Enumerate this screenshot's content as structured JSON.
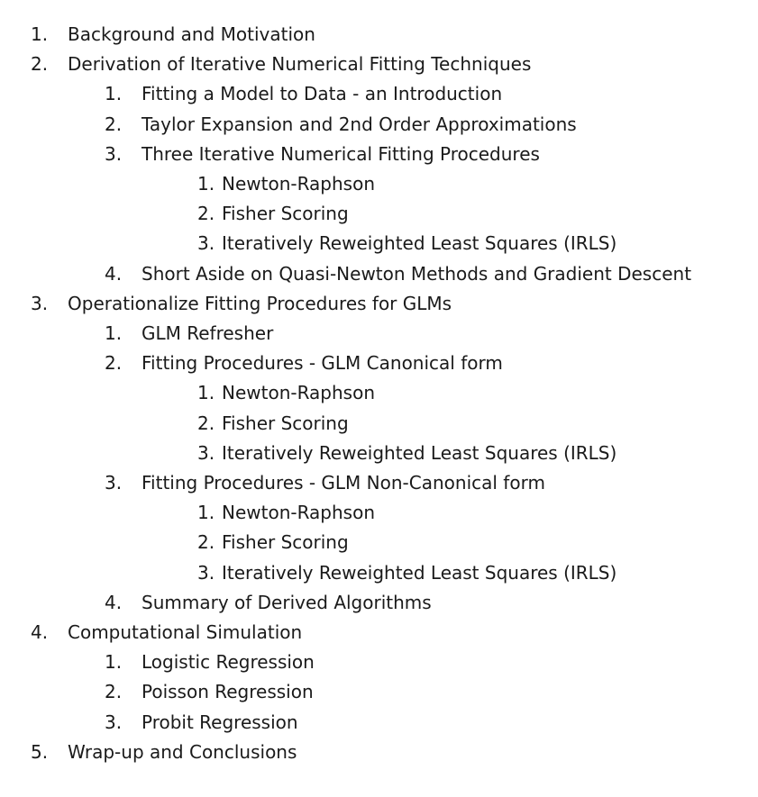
{
  "outline": [
    {
      "level": 1,
      "number": "1.",
      "text": "Background and Motivation"
    },
    {
      "level": 1,
      "number": "2.",
      "text": "Derivation of Iterative Numerical Fitting Techniques"
    },
    {
      "level": 2,
      "number": "1.",
      "text": "Fitting a Model to Data - an Introduction"
    },
    {
      "level": 2,
      "number": "2.",
      "text": "Taylor Expansion and 2nd Order Approximations"
    },
    {
      "level": 2,
      "number": "3.",
      "text": "Three Iterative Numerical Fitting Procedures"
    },
    {
      "level": 3,
      "number": "1.",
      "text": "Newton-Raphson"
    },
    {
      "level": 3,
      "number": "2.",
      "text": "Fisher Scoring"
    },
    {
      "level": 3,
      "number": "3.",
      "text": "Iteratively Reweighted Least Squares (IRLS)"
    },
    {
      "level": 2,
      "number": "4.",
      "text": "Short Aside on Quasi-Newton Methods and Gradient Descent"
    },
    {
      "level": 1,
      "number": "3.",
      "text": "Operationalize Fitting Procedures for GLMs"
    },
    {
      "level": 2,
      "number": "1.",
      "text": "GLM Refresher"
    },
    {
      "level": 2,
      "number": "2.",
      "text": "Fitting Procedures - GLM Canonical form"
    },
    {
      "level": 3,
      "number": "1.",
      "text": "Newton-Raphson"
    },
    {
      "level": 3,
      "number": "2.",
      "text": "Fisher Scoring"
    },
    {
      "level": 3,
      "number": "3.",
      "text": "Iteratively Reweighted Least Squares (IRLS)"
    },
    {
      "level": 2,
      "number": "3.",
      "text": "Fitting Procedures - GLM Non-Canonical form"
    },
    {
      "level": 3,
      "number": "1.",
      "text": "Newton-Raphson"
    },
    {
      "level": 3,
      "number": "2.",
      "text": "Fisher Scoring"
    },
    {
      "level": 3,
      "number": "3.",
      "text": "Iteratively Reweighted Least Squares (IRLS)"
    },
    {
      "level": 2,
      "number": "4.",
      "text": "Summary of Derived Algorithms"
    },
    {
      "level": 1,
      "number": "4.",
      "text": "Computational Simulation"
    },
    {
      "level": 2,
      "number": "1.",
      "text": "Logistic Regression"
    },
    {
      "level": 2,
      "number": "2.",
      "text": "Poisson Regression"
    },
    {
      "level": 2,
      "number": "3.",
      "text": "Probit Regression"
    },
    {
      "level": 1,
      "number": "5.",
      "text": "Wrap-up and Conclusions"
    }
  ]
}
